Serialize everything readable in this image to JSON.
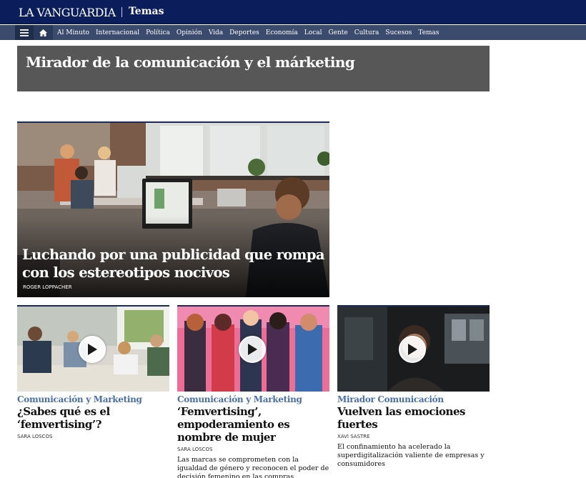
{
  "masthead": {
    "logo": "LA VANGUARDIA",
    "section": "Temas"
  },
  "nav": {
    "menu_icon": "hamburger-icon",
    "home_icon": "home-icon",
    "items": [
      "Al Minuto",
      "Internacional",
      "Política",
      "Opinión",
      "Vida",
      "Deportes",
      "Economía",
      "Local",
      "Gente",
      "Cultura",
      "Sucesos",
      "Temas"
    ]
  },
  "banner": {
    "title": "Mirador de la comunicación y el márketing"
  },
  "hero": {
    "title": "Luchando por una publicidad que rompa con los estereotipos nocivos",
    "author": "ROGER LOPPACHER"
  },
  "cards": [
    {
      "section": "Comunicación y Marketing",
      "title": "¿Sabes qué es el ‘femvertising’?",
      "author": "SARA LOSCOS",
      "description": ""
    },
    {
      "section": "Comunicación y Marketing",
      "title": "‘Femvertising’, empoderamiento es nombre de mujer",
      "author": "SARA LOSCOS",
      "description": "Las marcas se comprometen con la igualdad de género y reconocen el poder de decisión femenino en las compras"
    },
    {
      "section": "Mirador Comunicación",
      "title": "Vuelven las emociones fuertes",
      "author": "XAVI SASTRE",
      "description": "El confinamiento ha acelerado la superdigitalización valiente de empresas y consumidores"
    }
  ],
  "colors": {
    "masthead": "#0b1e5b",
    "navbar": "#3b4b6e",
    "banner": "#575757",
    "section_link": "#4a6fa5"
  }
}
